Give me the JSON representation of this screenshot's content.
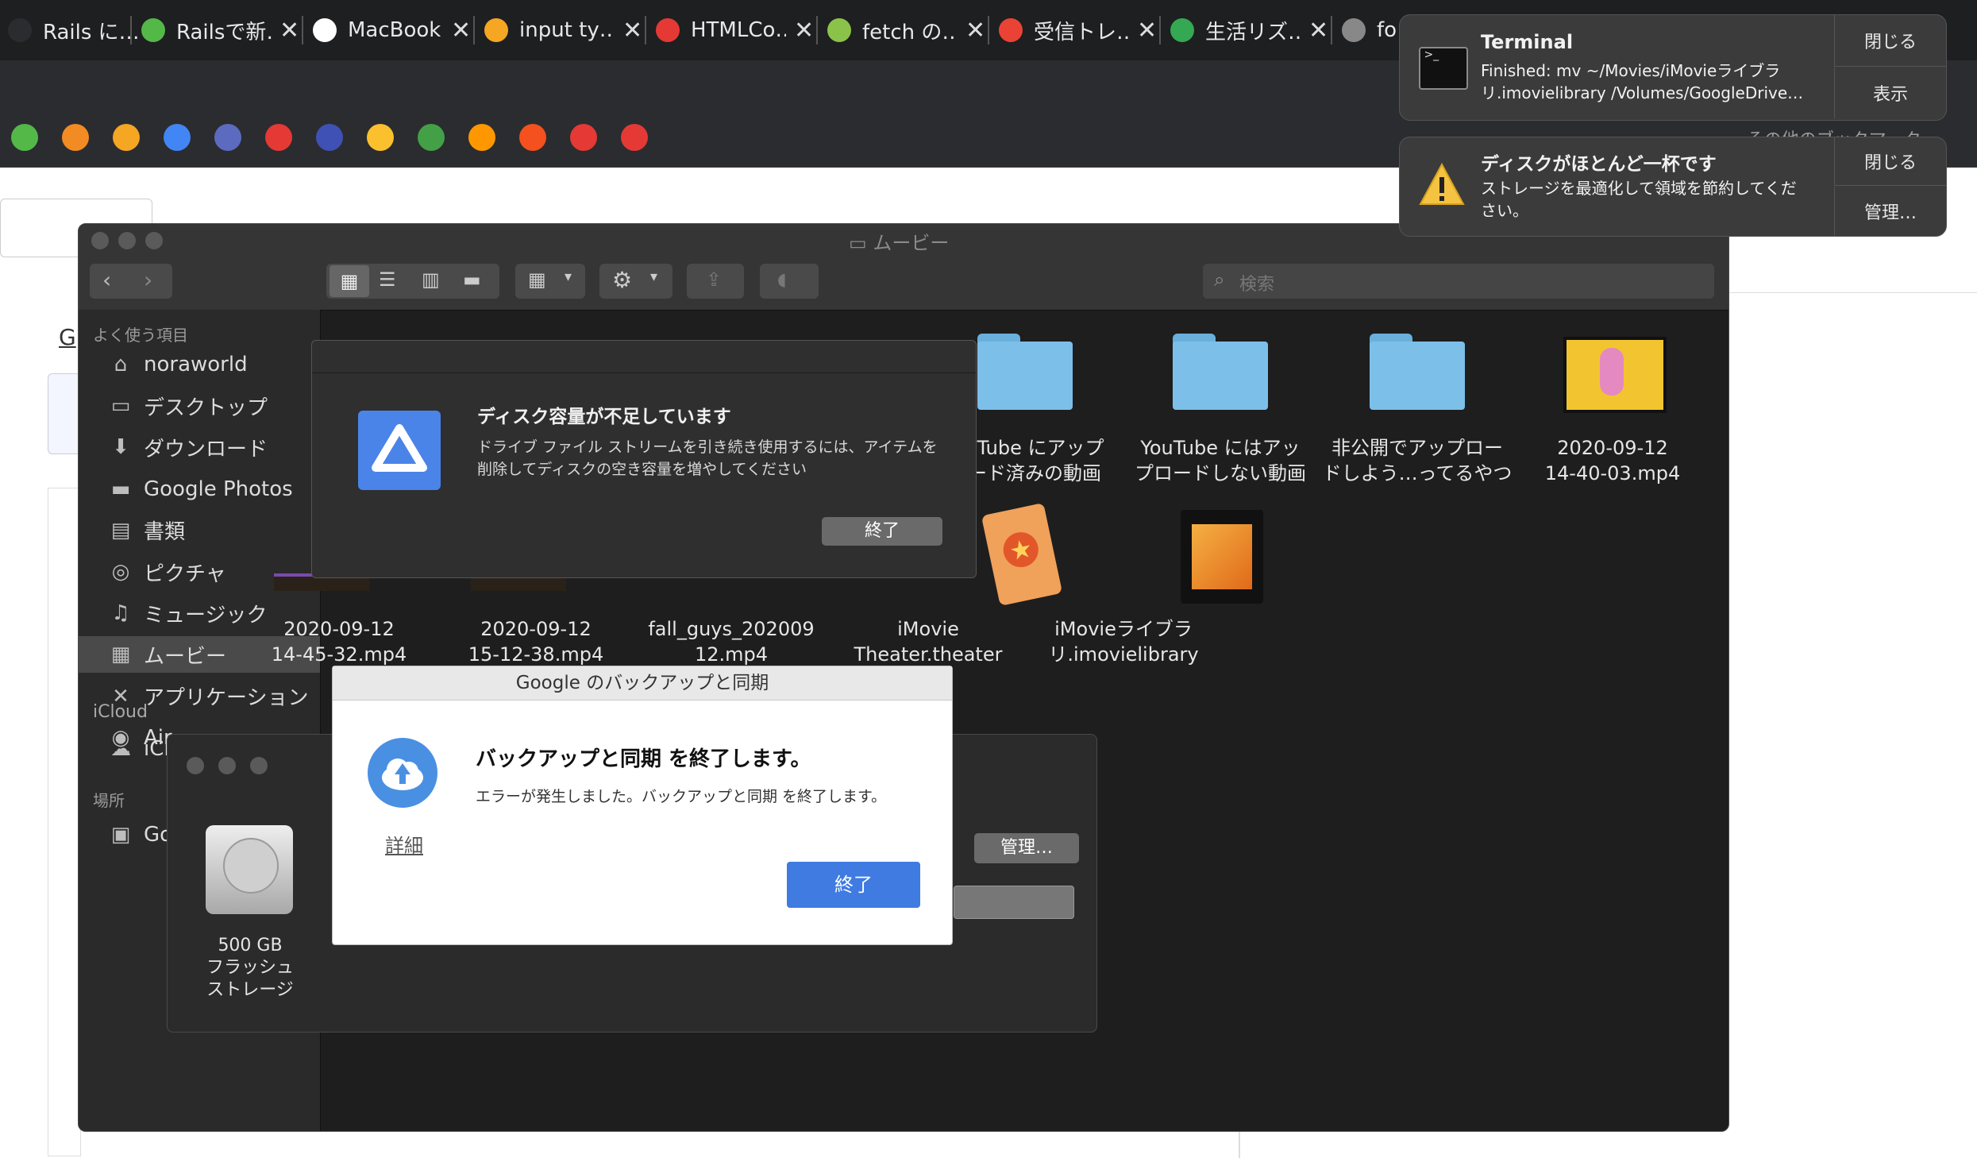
{
  "tabs": [
    {
      "title": "Rails に…",
      "color": "#2b2c2f"
    },
    {
      "title": "Railsで新…",
      "color": "#53b848"
    },
    {
      "title": "MacBook…",
      "color": "#ffffff"
    },
    {
      "title": "input ty…",
      "color": "#f5a623"
    },
    {
      "title": "HTMLCo…",
      "color": "#e53935"
    },
    {
      "title": "fetch の…",
      "color": "#8bc34a"
    },
    {
      "title": "受信トレ…",
      "color": "#ea4335"
    },
    {
      "title": "生活リズ…",
      "color": "#34a853"
    },
    {
      "title": "fo…",
      "color": "#888888"
    }
  ],
  "tab_close": "✕",
  "bookmarks": {
    "other_label": "その他のブックマーク",
    "colors": [
      "#53b848",
      "#f28b24",
      "#f5a623",
      "#4285f4",
      "#5c6bc0",
      "#e53935",
      "#3f51b5",
      "#fbc02d",
      "#43a047",
      "#ff9800",
      "#f4511e",
      "#e53935",
      "#e53935"
    ]
  },
  "finder": {
    "title": "ムービー",
    "search_placeholder": "検索",
    "sidebar": {
      "favorites_header": "よく使う項目",
      "items": [
        {
          "label": "noraworld",
          "icon": "⌂"
        },
        {
          "label": "デスクトップ",
          "icon": "▭"
        },
        {
          "label": "ダウンロード",
          "icon": "⬇"
        },
        {
          "label": "Google Photos",
          "icon": "▬"
        },
        {
          "label": "書類",
          "icon": "▤"
        },
        {
          "label": "ピクチャ",
          "icon": "◎"
        },
        {
          "label": "ミュージック",
          "icon": "♫"
        },
        {
          "label": "ムービー",
          "icon": "▦"
        },
        {
          "label": "アプリケーション",
          "icon": "✕"
        },
        {
          "label": "Air…",
          "icon": "◉"
        }
      ],
      "icloud_header": "iCloud",
      "icloud_item": "iCl…",
      "places_header": "場所",
      "places_item": "Go…"
    },
    "files_row1": [
      {
        "l1": "…uTube にアップ",
        "l2": "…ード済みの動画"
      },
      {
        "l1": "YouTube にはアッ",
        "l2": "プロードしない動画"
      },
      {
        "l1": "非公開でアップロー",
        "l2": "ドしよう…ってるやつ"
      },
      {
        "l1": "2020-09-12",
        "l2": "14-40-03.mp4"
      }
    ],
    "files_row2": [
      {
        "l1": "2020-09-12",
        "l2": "14-45-32.mp4"
      },
      {
        "l1": "2020-09-12",
        "l2": "15-12-38.mp4"
      },
      {
        "l1": "fall_guys_202009",
        "l2": "12.mp4"
      },
      {
        "l1": "iMovie",
        "l2": "Theater.theater"
      },
      {
        "l1": "iMovieライブラ",
        "l2": "リ.imovielibrary"
      }
    ]
  },
  "drive_dialog": {
    "title": "ディスク容量が不足しています",
    "body": "ドライブ ファイル ストリームを引き続き使用するには、アイテムを削除してディスクの空き容量を増やしてください",
    "button": "終了"
  },
  "backup_dialog": {
    "window_title": "Google のバックアップと同期",
    "heading": "バックアップと同期 を終了します。",
    "body": "エラーが発生しました。バックアップと同期 を終了します。",
    "details_link": "詳細",
    "button": "終了"
  },
  "disk_window": {
    "disk_l1": "500 GB",
    "disk_l2": "フラッシュ",
    "disk_l3": "ストレージ",
    "manage_button": "管理…"
  },
  "notifications": [
    {
      "title": "Terminal",
      "body": "Finished: mv ~/Movies/iMovieライブラリ.imovielibrary /Volumes/GoogleDrive…",
      "btn1": "閉じる",
      "btn2": "表示"
    },
    {
      "title": "ディスクがほとんど一杯です",
      "body": "ストレージを最適化して領域を節約してください。",
      "btn1": "閉じる",
      "btn2": "管理…"
    }
  ],
  "page_behind": {
    "letter": "G"
  }
}
